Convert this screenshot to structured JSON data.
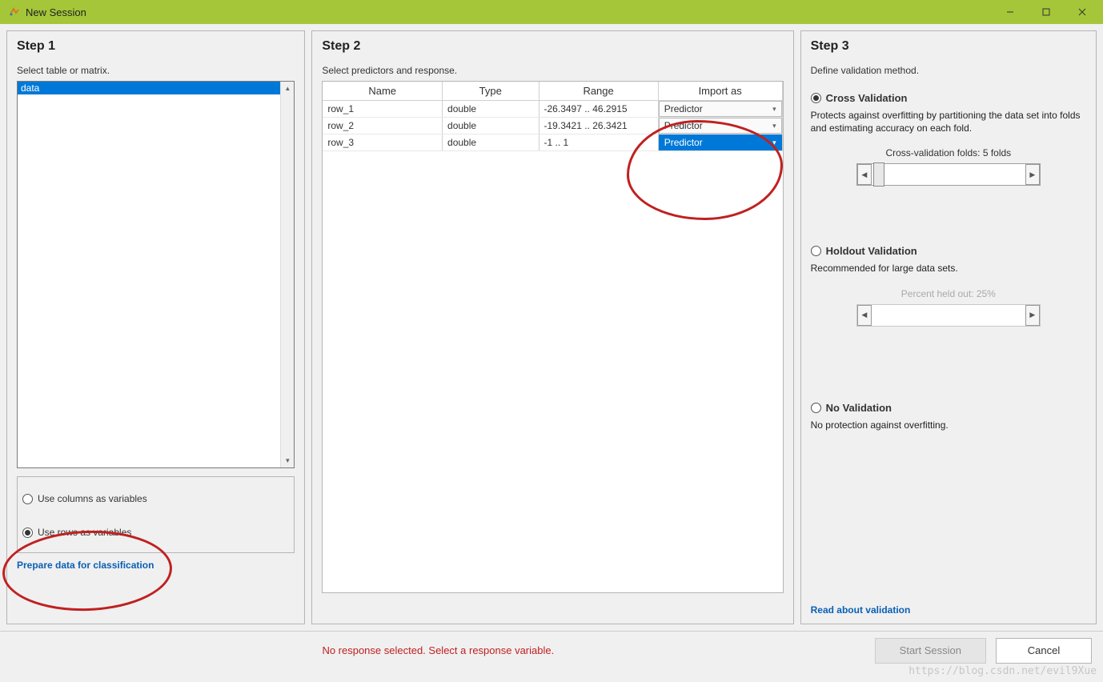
{
  "window": {
    "title": "New Session"
  },
  "step1": {
    "title": "Step 1",
    "label": "Select table or matrix.",
    "items": [
      "data"
    ],
    "orientation": {
      "columns": "Use columns as variables",
      "rows": "Use rows as variables",
      "selected": "rows"
    },
    "link": "Prepare data for classification"
  },
  "step2": {
    "title": "Step 2",
    "label": "Select predictors and response.",
    "headers": {
      "name": "Name",
      "type": "Type",
      "range": "Range",
      "import_as": "Import as"
    },
    "rows": [
      {
        "name": "row_1",
        "type": "double",
        "range": "-26.3497 .. 46.2915",
        "import_as": "Predictor",
        "selected": false
      },
      {
        "name": "row_2",
        "type": "double",
        "range": "-19.3421 .. 26.3421",
        "import_as": "Predictor",
        "selected": false
      },
      {
        "name": "row_3",
        "type": "double",
        "range": "-1 .. 1",
        "import_as": "Predictor",
        "selected": true
      }
    ]
  },
  "step3": {
    "title": "Step 3",
    "label": "Define validation method.",
    "cross": {
      "label": "Cross Validation",
      "desc": "Protects against overfitting by partitioning the data set into folds and estimating accuracy on each fold.",
      "slider_label": "Cross-validation folds: 5 folds"
    },
    "holdout": {
      "label": "Holdout Validation",
      "desc": "Recommended for large data sets.",
      "slider_label": "Percent held out: 25%"
    },
    "none": {
      "label": "No Validation",
      "desc": "No protection against overfitting."
    },
    "selected": "cross",
    "link": "Read about validation"
  },
  "footer": {
    "message": "No response selected. Select a response variable.",
    "start": "Start Session",
    "cancel": "Cancel"
  },
  "watermark": "https://blog.csdn.net/evil9Xue"
}
